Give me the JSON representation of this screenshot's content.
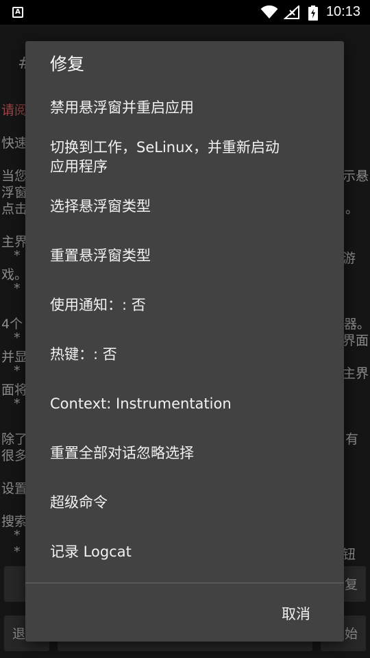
{
  "status_bar": {
    "time": "10:13",
    "app_icon_letter": "A",
    "icons": [
      "wifi-icon",
      "signal-icon",
      "battery-icon"
    ]
  },
  "background": {
    "lines": [
      "#",
      "请阅",
      "快速",
      "当您",
      "示悬",
      "浮窗",
      "点击",
      "。",
      "主界",
      "*",
      "游",
      "戏。",
      "*",
      "4个",
      "器。",
      "*",
      "界面",
      "并显",
      "*",
      "主界",
      "面将",
      "*",
      "除了",
      "有",
      "很多",
      "设置",
      "搜索",
      "*",
      "*",
      "钮"
    ],
    "buttons": {
      "fix": "复",
      "exit": "退",
      "start": "始"
    }
  },
  "dialog": {
    "title": "修复",
    "items": [
      "禁用悬浮窗并重启应用",
      "切换到工作，SeLinux，并重新启动应用程序",
      "选择悬浮窗类型",
      "重置悬浮窗类型",
      "使用通知：: 否",
      "热键：: 否",
      "Context: Instrumentation",
      "重置全部对话忽略选择",
      "超级命令",
      "记录 Logcat"
    ],
    "item_2_line_1": "切换到工作，SeLinux，并重新启动",
    "item_2_line_2": "应用程序",
    "cancel_label": "取消"
  },
  "colors": {
    "dialog_bg": "#424242",
    "background": "#1f1f1f",
    "accent_red": "#e06666"
  }
}
